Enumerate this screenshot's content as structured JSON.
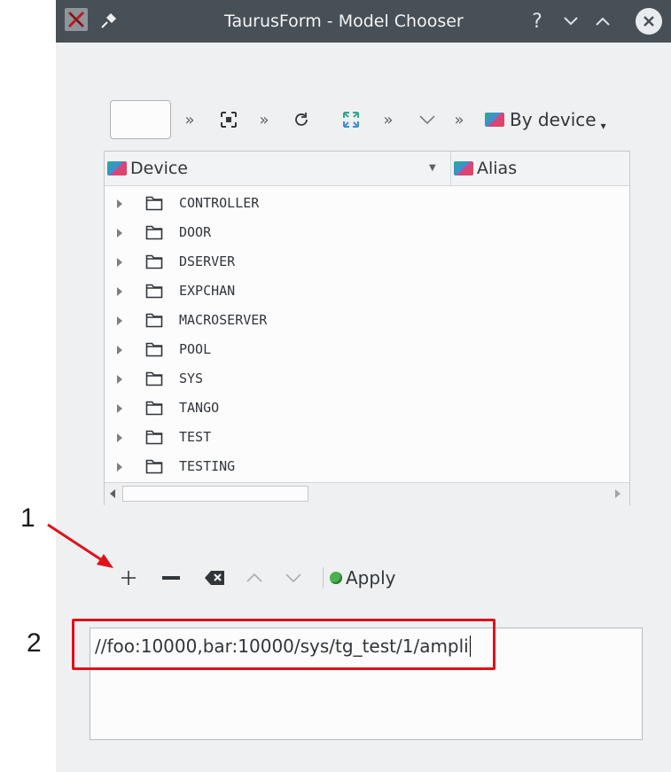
{
  "window": {
    "title": "TaurusForm - Model Chooser",
    "help": "?"
  },
  "tree_toolbar": {
    "filter_value": "",
    "group_label": "By device"
  },
  "tree": {
    "columns": [
      "Device",
      "Alias"
    ],
    "items": [
      {
        "label": "CONTROLLER"
      },
      {
        "label": "DOOR"
      },
      {
        "label": "DSERVER"
      },
      {
        "label": "EXPCHAN"
      },
      {
        "label": "MACROSERVER"
      },
      {
        "label": "POOL"
      },
      {
        "label": "SYS"
      },
      {
        "label": "TANGO"
      },
      {
        "label": "TEST"
      },
      {
        "label": "TESTING"
      }
    ]
  },
  "list_toolbar": {
    "apply_label": "Apply"
  },
  "model_text": "//foo:10000,bar:10000/sys/tg_test/1/ampli",
  "annotations": {
    "marker_1": "1",
    "marker_2": "2",
    "color": "#e0101b"
  },
  "colors": {
    "titlebar": "#475057",
    "window_bg": "#eff0f1",
    "accent_red": "#e0101b"
  }
}
